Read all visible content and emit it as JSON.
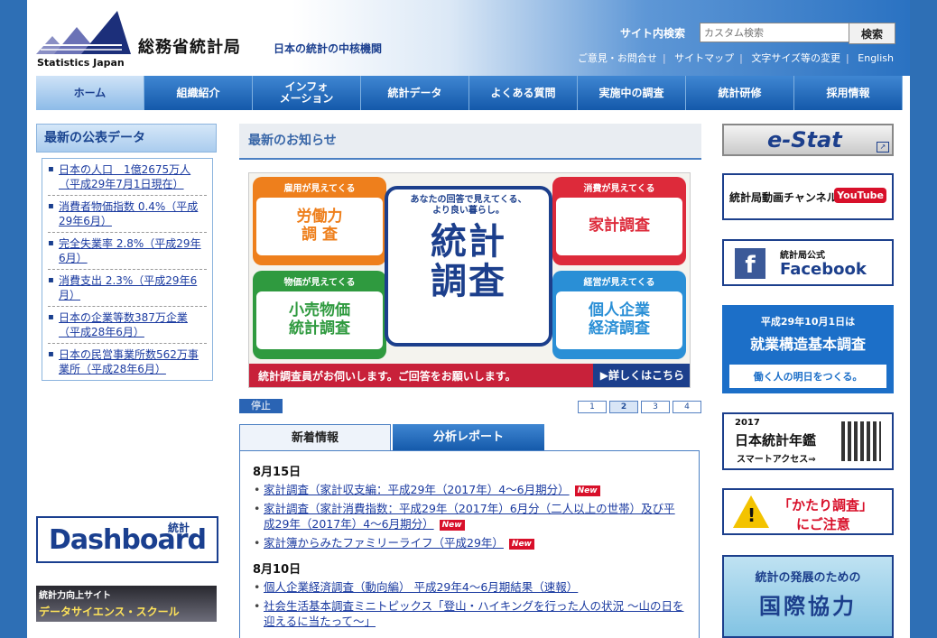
{
  "header": {
    "logo_en": "Statistics Japan",
    "logo_jp": "総務省統計局",
    "tagline": "日本の統計の中核機関",
    "search_label": "サイト内検索",
    "search_placeholder": "カスタム検索",
    "search_button": "検索",
    "util_links": [
      "ご意見・お問合せ",
      "サイトマップ",
      "文字サイズ等の変更",
      "English"
    ]
  },
  "nav": [
    {
      "label": "ホーム",
      "active": true
    },
    {
      "label": "組織紹介"
    },
    {
      "label": "インフォ\nメーション"
    },
    {
      "label": "統計データ"
    },
    {
      "label": "よくある質問"
    },
    {
      "label": "実施中の調査"
    },
    {
      "label": "統計研修"
    },
    {
      "label": "採用情報"
    }
  ],
  "left": {
    "title": "最新の公表データ",
    "items": [
      "日本の人口　1億2675万人（平成29年7月1日現在）",
      "消費者物価指数 0.4%（平成29年6月）",
      "完全失業率 2.8%（平成29年6月）",
      "消費支出 2.3%（平成29年6月）",
      "日本の企業等数387万企業（平成28年6月）",
      "日本の民営事業所数562万事業所（平成28年6月）"
    ],
    "dashboard_label": "Dashboard",
    "dashboard_tag": "統計",
    "ds_top": "統計力向上サイト",
    "ds_bottom": "データサイエンス・スクール"
  },
  "center": {
    "title": "最新のお知らせ",
    "carousel": {
      "cards": [
        {
          "cap": "雇用が見えてくる",
          "text": "労働力\n調 査",
          "color": "#ee7f1c"
        },
        {
          "cap": "消費が見えてくる",
          "text": "家計調査",
          "color": "#dd2a3a"
        },
        {
          "cap": "物価が見えてくる",
          "text": "小売物価\n統計調査",
          "color": "#2f9a3f"
        },
        {
          "cap": "経営が見えてくる",
          "text": "個人企業\n経済調査",
          "color": "#2a8fd6"
        }
      ],
      "center_top": "あなたの回答で見えてくる、\nより良い暮らし。",
      "center_big1": "統計",
      "center_big2": "調査",
      "bottom_text": "統計調査員がお伺いします。ご回答をお願いします。",
      "bottom_link": "▶詳しくはこちら"
    },
    "stop_label": "停止",
    "pages": [
      "1",
      "2",
      "3",
      "4"
    ],
    "active_page": 2,
    "tabs": [
      "新着情報",
      "分析レポート"
    ],
    "new_label": "New",
    "news": [
      {
        "date": "8月15日",
        "items": [
          {
            "text": "家計調査（家計収支編：平成29年（2017年）4～6月期分）",
            "new": true
          },
          {
            "text": "家計調査（家計消費指数：平成29年（2017年）6月分（二人以上の世帯）及び平成29年（2017年）4～6月期分）",
            "new": true
          },
          {
            "text": "家計簿からみたファミリーライフ（平成29年）",
            "new": true
          }
        ]
      },
      {
        "date": "8月10日",
        "items": [
          {
            "text": "個人企業経済調査（動向編） 平成29年4～6月期結果（速報）",
            "new": false
          },
          {
            "text": "社会生活基本調査ミニトピックス「登山・ハイキングを行った人の状況 ～山の日を迎えるに当たって～」",
            "new": false
          }
        ]
      }
    ]
  },
  "right": {
    "estat": "e-Stat",
    "video_channel": "統計局動画チャンネル",
    "youtube": "YouTube",
    "fb_small": "統計局公式",
    "fb_big": "Facebook",
    "survey_top": "平成29年10月1日は",
    "survey_mid": "就業構造基本調査",
    "survey_bottom": "働く人の明日をつくる。",
    "yearbook_year": "2017",
    "yearbook_title": "日本統計年鑑",
    "yearbook_sub": "スマートアクセス⇒",
    "warning_line1": "「かたり調査」",
    "warning_line2": "にご注意",
    "intl_line1": "統計の発展のための",
    "intl_line2": "国際協力"
  }
}
